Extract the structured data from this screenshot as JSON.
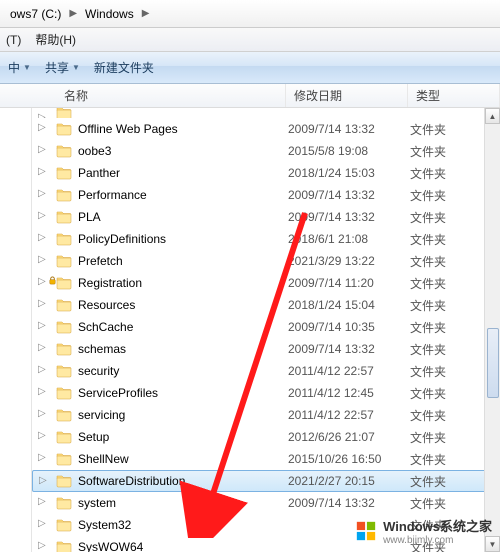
{
  "breadcrumb": {
    "items": [
      "ows7 (C:)",
      "Windows"
    ]
  },
  "menu": {
    "tools_suffix": "(T)",
    "help": "帮助(H)"
  },
  "toolbar": {
    "include": "中",
    "share": "共享",
    "new_folder": "新建文件夹"
  },
  "columns": {
    "name": "名称",
    "modified": "修改日期",
    "type": "类型"
  },
  "type_label": "文件夹",
  "files": [
    {
      "name": "",
      "date": "",
      "top_cut": true
    },
    {
      "name": "Offline Web Pages",
      "date": "2009/7/14 13:32"
    },
    {
      "name": "oobe3",
      "date": "2015/5/8 19:08"
    },
    {
      "name": "Panther",
      "date": "2018/1/24 15:03"
    },
    {
      "name": "Performance",
      "date": "2009/7/14 13:32"
    },
    {
      "name": "PLA",
      "date": "2009/7/14 13:32"
    },
    {
      "name": "PolicyDefinitions",
      "date": "2018/6/1 21:08"
    },
    {
      "name": "Prefetch",
      "date": "2021/3/29 13:22",
      "locked": true
    },
    {
      "name": "Registration",
      "date": "2009/7/14 11:20"
    },
    {
      "name": "Resources",
      "date": "2018/1/24 15:04"
    },
    {
      "name": "SchCache",
      "date": "2009/7/14 10:35"
    },
    {
      "name": "schemas",
      "date": "2009/7/14 13:32"
    },
    {
      "name": "security",
      "date": "2011/4/12 22:57"
    },
    {
      "name": "ServiceProfiles",
      "date": "2011/4/12 12:45"
    },
    {
      "name": "servicing",
      "date": "2011/4/12 22:57"
    },
    {
      "name": "Setup",
      "date": "2012/6/26 21:07"
    },
    {
      "name": "ShellNew",
      "date": "2015/10/26 16:50"
    },
    {
      "name": "SoftwareDistribution",
      "date": "2021/2/27 20:15",
      "selected": true
    },
    {
      "name": "system",
      "date": "2009/7/14 13:32"
    },
    {
      "name": "System32",
      "date": ""
    },
    {
      "name": "SysWOW64",
      "date": ""
    }
  ],
  "watermark": {
    "title": "Windows系统之家",
    "url": "www.bjjmlv.com"
  }
}
